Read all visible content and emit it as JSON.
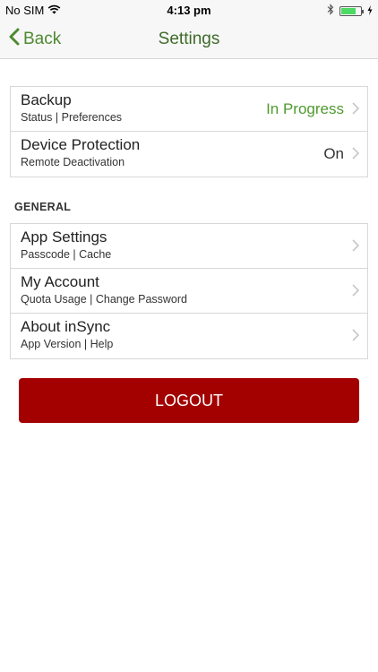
{
  "status_bar": {
    "carrier": "No SIM",
    "time": "4:13 pm",
    "battery_level": 0.7,
    "battery_color": "#4cd964"
  },
  "nav": {
    "back_label": "Back",
    "title": "Settings",
    "accent_color": "#4f8a2f"
  },
  "group1": [
    {
      "title": "Backup",
      "subtitle": "Status | Preferences",
      "value": "In Progress",
      "value_color": "#4f9a2f"
    },
    {
      "title": "Device Protection",
      "subtitle": "Remote Deactivation",
      "value": "On",
      "value_color": "#333333"
    }
  ],
  "general": {
    "header": "GENERAL",
    "items": [
      {
        "title": "App Settings",
        "subtitle": "Passcode | Cache"
      },
      {
        "title": "My Account",
        "subtitle": "Quota Usage | Change Password"
      },
      {
        "title": "About inSync",
        "subtitle": "App Version | Help"
      }
    ]
  },
  "logout": {
    "label": "LOGOUT",
    "color": "#a30000"
  }
}
